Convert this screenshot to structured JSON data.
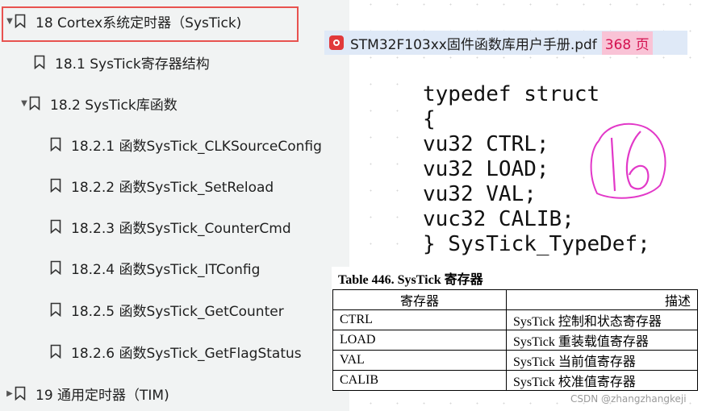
{
  "bookmarks": {
    "items": [
      {
        "label": "18 Cortex系统定时器（SysTick)",
        "arrow": "▼"
      },
      {
        "label": "18.1 SysTick寄存器结构",
        "arrow": ""
      },
      {
        "label": "18.2 SysTick库函数",
        "arrow": "▼"
      },
      {
        "label": "18.2.1 函数SysTick_CLKSourceConfig",
        "arrow": ""
      },
      {
        "label": "18.2.2 函数SysTick_SetReload",
        "arrow": ""
      },
      {
        "label": "18.2.3 函数SysTick_CounterCmd",
        "arrow": ""
      },
      {
        "label": "18.2.4 函数SysTick_ITConfig",
        "arrow": ""
      },
      {
        "label": "18.2.5 函数SysTick_GetCounter",
        "arrow": ""
      },
      {
        "label": "18.2.6 函数SysTick_GetFlagStatus",
        "arrow": ""
      },
      {
        "label": "19 通用定时器（TIM)",
        "arrow": "▶"
      }
    ]
  },
  "file": {
    "name": "STM32F103xx固件函数库用户手册.pdf",
    "pages": "368 页"
  },
  "code": {
    "lines": [
      "typedef struct",
      "{",
      "vu32 CTRL;",
      "vu32 LOAD;",
      "vu32 VAL;",
      "vuc32 CALIB;",
      "} SysTick_TypeDef;"
    ],
    "annotation": "16"
  },
  "table": {
    "caption": "Table 446. SysTick 寄存器",
    "headers": [
      "寄存器",
      "描述"
    ],
    "rows": [
      [
        "CTRL",
        "SysTick 控制和状态寄存器"
      ],
      [
        "LOAD",
        "SysTick 重装载值寄存器"
      ],
      [
        "VAL",
        "SysTick 当前值寄存器"
      ],
      [
        "CALIB",
        "SysTick 校准值寄存器"
      ]
    ]
  },
  "watermark": "CSDN @zhangzhangkeji"
}
